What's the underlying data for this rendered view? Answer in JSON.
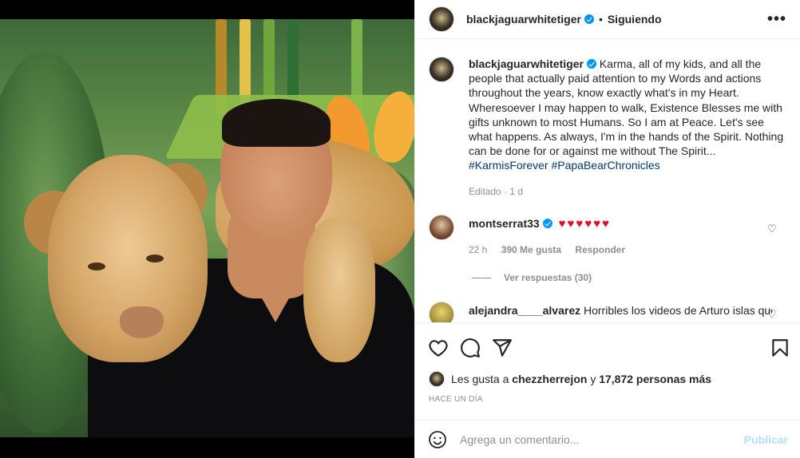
{
  "post": {
    "username": "blackjaguarwhitetiger",
    "follow_status": "Siguiendo",
    "dot": "•",
    "more": "•••",
    "caption_body": "Karma, all of my kids, and all the people that actually paid attention to my Words and actions throughout the years, know exactly what's in my Heart. Wheresoever I may happen to walk, Existence Blesses me with gifts unknown to most Humans. So I am at Peace. Let's see what happens. As always, I'm in the hands of the Spirit. Nothing can be done for or against me without The Spirit...",
    "hashtags": [
      "#KarmisForever",
      "#PapaBearChronicles"
    ],
    "caption_meta": "Editado · 1 d"
  },
  "comments": [
    {
      "username": "montserrat33",
      "text": "♥♥♥♥♥♥",
      "time": "22 h",
      "likes": "390 Me gusta",
      "reply": "Responder",
      "view_replies": "Ver respuestas (30)"
    },
    {
      "username": "alejandra____alvarez",
      "text": "Horribles los videos de Arturo islas que"
    }
  ],
  "footer": {
    "likes_prefix": "Les gusta a",
    "likes_user": "chezzherrejon",
    "likes_conj": "y",
    "likes_rest": "17,872 personas más",
    "time_ago": "HACE UN DÍA",
    "add_comment_placeholder": "Agrega un comentario...",
    "publish": "Publicar"
  },
  "icons": [
    "heart-icon",
    "comment-icon",
    "share-icon",
    "bookmark-icon",
    "emoji-icon",
    "more-icon",
    "verified-icon"
  ],
  "colors": {
    "verified": "#0095f6",
    "hashtag": "#00376b",
    "muted": "#8e8e8e",
    "publish_disabled": "#b2dffc",
    "hearts": "#e0102b"
  }
}
